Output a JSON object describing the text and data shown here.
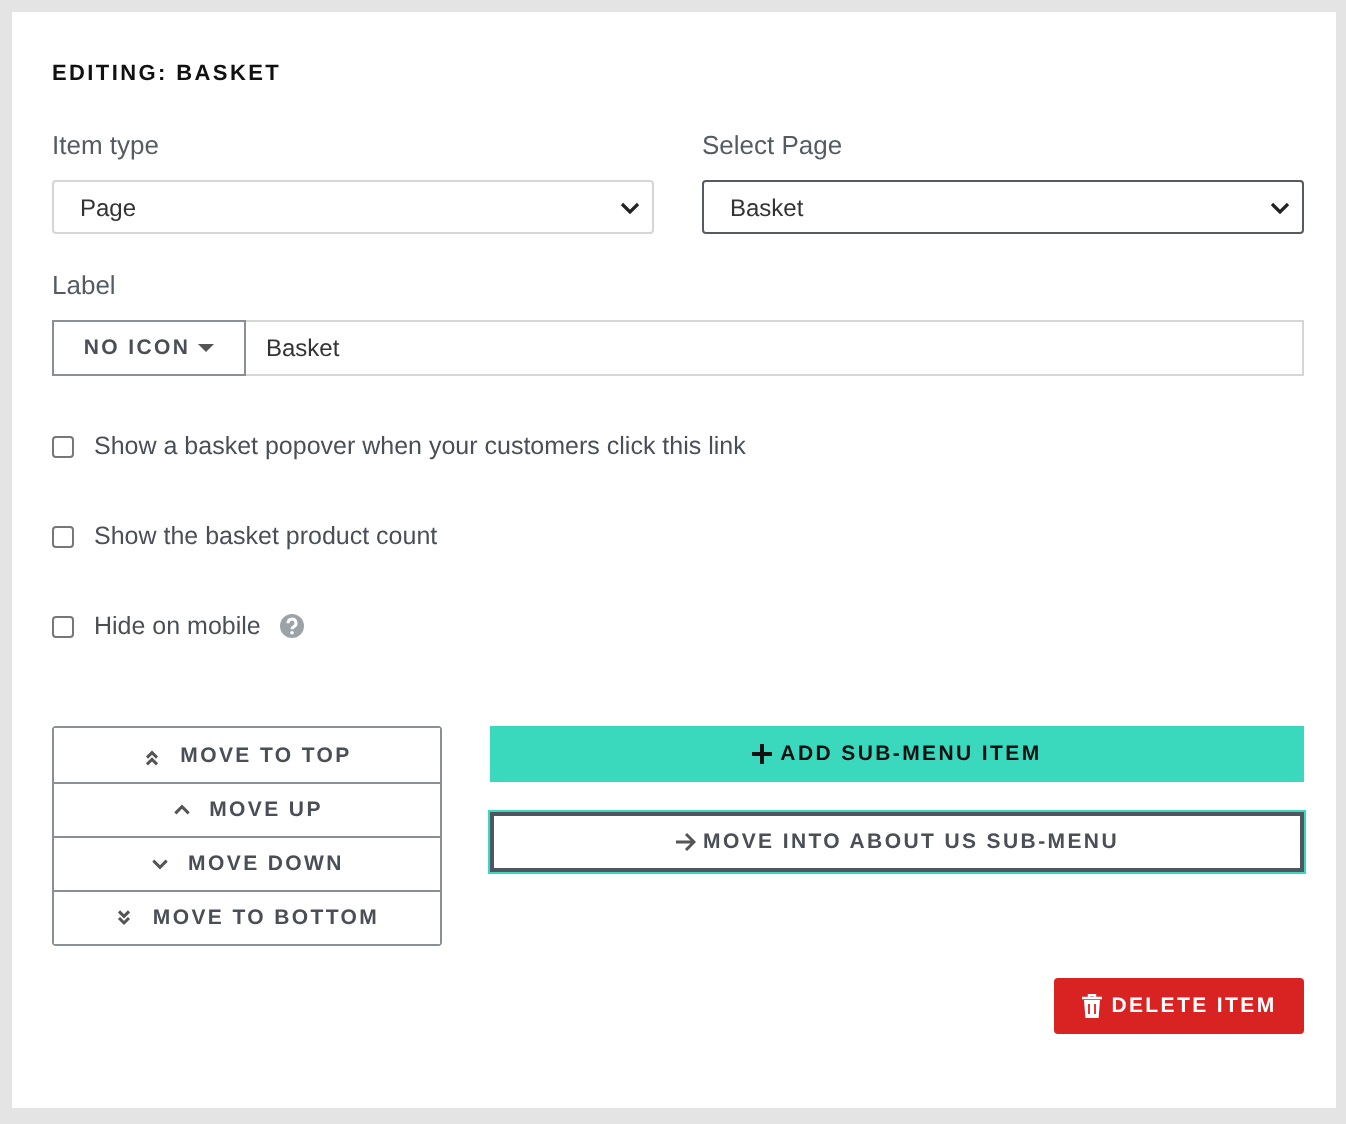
{
  "title": "EDITING: BASKET",
  "selects": [
    {
      "label": "Item type",
      "value": "Page",
      "focused": false
    },
    {
      "label": "Select Page",
      "value": "Basket",
      "focused": true
    }
  ],
  "label_field": {
    "label": "Label",
    "icon_button": "NO ICON",
    "value": "Basket"
  },
  "options": [
    {
      "text": "Show a basket popover when your customers click this link",
      "checked": false,
      "help": false
    },
    {
      "text": "Show the basket product count",
      "checked": false,
      "help": false
    },
    {
      "text": "Hide on mobile",
      "checked": false,
      "help": true
    }
  ],
  "move_buttons": [
    {
      "kind": "top",
      "label": "MOVE TO TOP"
    },
    {
      "kind": "up",
      "label": "MOVE UP"
    },
    {
      "kind": "down",
      "label": "MOVE DOWN"
    },
    {
      "kind": "bottom",
      "label": "MOVE TO BOTTOM"
    }
  ],
  "add_button": "ADD SUB-MENU ITEM",
  "move_into_button": "MOVE INTO ABOUT US SUB-MENU",
  "delete_button": "DELETE ITEM"
}
